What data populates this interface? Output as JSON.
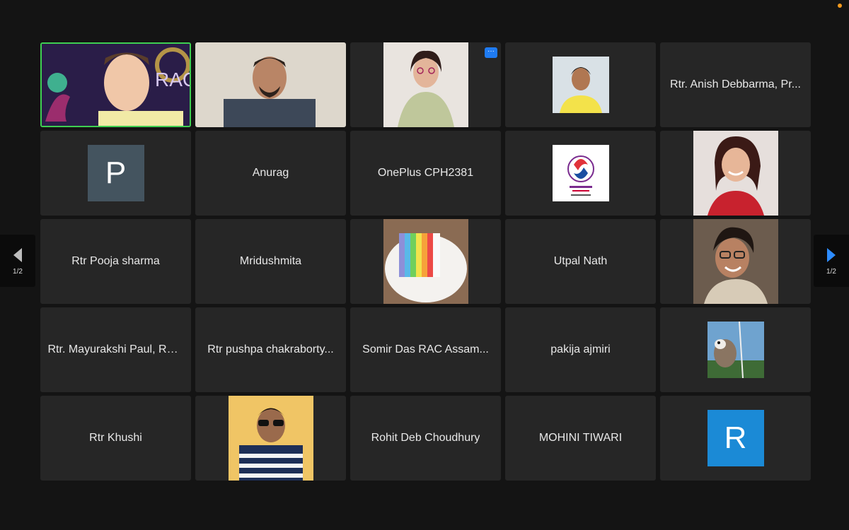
{
  "colors": {
    "active_speaker_border": "#3ecf51",
    "tile_bg": "#262626",
    "nav_arrow_left": "#bdbdbd",
    "nav_arrow_right": "#2d8cff",
    "avatar_p": "#44545f",
    "avatar_r": "#1b8ad6"
  },
  "tiles": [
    {
      "kind": "video",
      "icon": "speaker-video",
      "label": ""
    },
    {
      "kind": "video",
      "icon": "man-video",
      "label": ""
    },
    {
      "kind": "photo",
      "icon": "woman-photo",
      "label": ""
    },
    {
      "kind": "photo",
      "icon": "man-photo",
      "label": ""
    },
    {
      "kind": "name",
      "label": "Rtr. Anish Debbarma, Pr..."
    },
    {
      "kind": "avatar",
      "avatar": "P",
      "label": ""
    },
    {
      "kind": "name",
      "label": "Anurag"
    },
    {
      "kind": "name",
      "label": "OnePlus CPH2381"
    },
    {
      "kind": "photo",
      "icon": "rotaract-logo",
      "label": ""
    },
    {
      "kind": "photo",
      "icon": "girl-photo",
      "label": ""
    },
    {
      "kind": "name",
      "label": "Rtr Pooja sharma"
    },
    {
      "kind": "name",
      "label": "Mridushmita"
    },
    {
      "kind": "photo",
      "icon": "rainbow-cake-photo",
      "label": ""
    },
    {
      "kind": "name",
      "label": "Utpal Nath"
    },
    {
      "kind": "photo",
      "icon": "man-glasses-photo",
      "label": ""
    },
    {
      "kind": "name",
      "label": "Rtr. Mayurakshi Paul, RA..."
    },
    {
      "kind": "name",
      "label": "Rtr pushpa chakraborty..."
    },
    {
      "kind": "name",
      "label": "Somir Das RAC Assam..."
    },
    {
      "kind": "name",
      "label": "pakija ajmiri"
    },
    {
      "kind": "photo",
      "icon": "dog-photo",
      "label": ""
    },
    {
      "kind": "name",
      "label": "Rtr Khushi"
    },
    {
      "kind": "photo",
      "icon": "man-sunglasses-photo",
      "label": ""
    },
    {
      "kind": "name",
      "label": "Rohit Deb Choudhury"
    },
    {
      "kind": "name",
      "label": "MOHINI TIWARI"
    },
    {
      "kind": "avatar",
      "avatar": "R",
      "label": ""
    }
  ],
  "nav": {
    "left_page": "1/2",
    "right_page": "1/2"
  }
}
